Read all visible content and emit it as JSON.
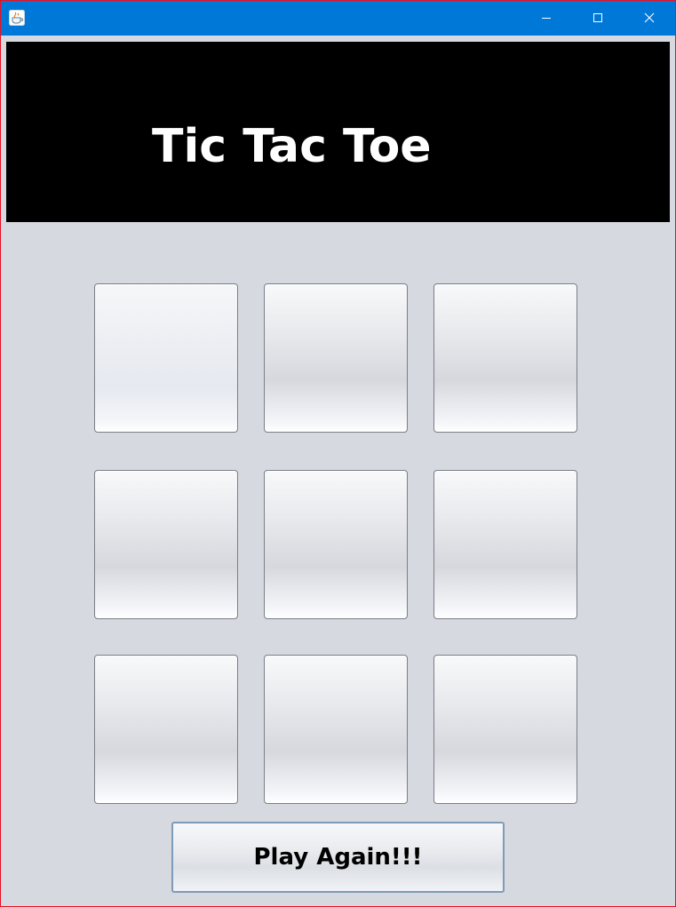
{
  "window": {
    "border_color": "#e81123",
    "background": "#d6d9df"
  },
  "titlebar": {
    "background": "#0078d7",
    "app_icon": "java-cup-icon",
    "controls": [
      "minimize-icon",
      "maximize-icon",
      "close-icon"
    ]
  },
  "banner": {
    "title": "Tic Tac Toe",
    "background": "#000000",
    "text_color": "#ffffff"
  },
  "board": {
    "cells": [
      "",
      "",
      "",
      "",
      "",
      "",
      "",
      "",
      ""
    ]
  },
  "actions": {
    "play_again_label": "Play Again!!!"
  }
}
